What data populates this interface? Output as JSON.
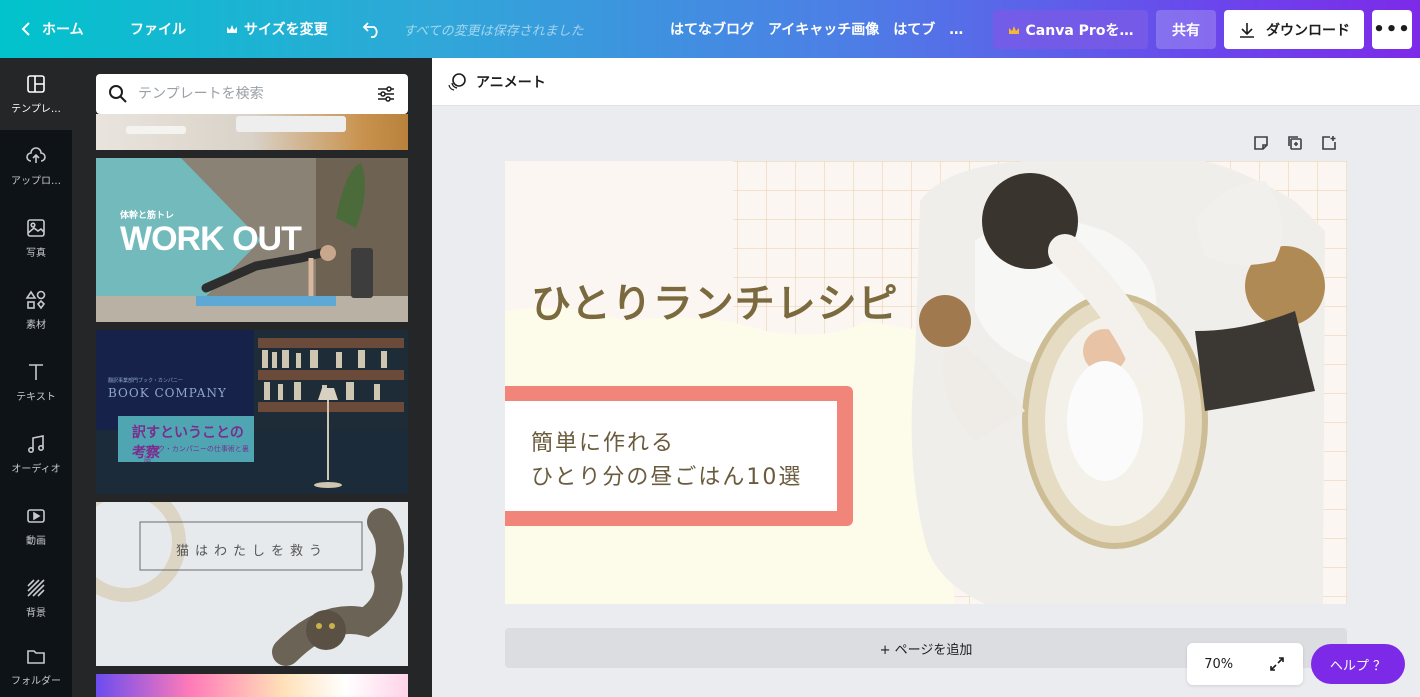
{
  "topbar": {
    "home": "ホーム",
    "file": "ファイル",
    "resize": "サイズを変更",
    "saved": "すべての変更は保存されました",
    "doc_title": "はてなブログ　アイキャッチ画像　はてブ　…",
    "pro": "Canva Proを…",
    "share": "共有",
    "download": "ダウンロード",
    "more": "•••"
  },
  "rail": {
    "templates": "テンプレ…",
    "uploads": "アップロ…",
    "photos": "写真",
    "elements": "素材",
    "text": "テキスト",
    "audio": "オーディオ",
    "video": "動画",
    "background": "背景",
    "folder": "フォルダー"
  },
  "panel": {
    "search_placeholder": "テンプレートを検索",
    "thumb1_small": "体幹と筋トレ",
    "thumb1_title": "WORK OUT",
    "thumb2_small": "翻訳事業部門ブック・カンパニー",
    "thumb2_brand": "BOOK COMPANY",
    "thumb2_title": "訳すということの考察",
    "thumb2_sub": "ブック・カンパニーの仕事術と裏話",
    "thumb3_title": "猫はわたしを救う"
  },
  "editor": {
    "animate": "アニメート",
    "headline": "ひとりランチレシピ",
    "box_line1": "簡単に作れる",
    "box_line2": "ひとり分の昼ごはん10選",
    "add_page": "+ ページを追加",
    "zoom": "70%",
    "help": "ヘルプ ？"
  },
  "colors": {
    "accent": "#7d2ae8",
    "headline": "#7a6a3e",
    "frame": "#f28579"
  }
}
